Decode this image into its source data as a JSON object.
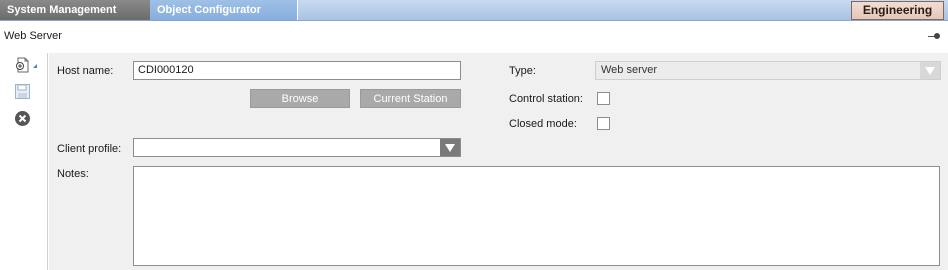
{
  "tabs": {
    "system_management": "System Management",
    "object_configurator": "Object Configurator",
    "engineering": "Engineering"
  },
  "page": {
    "title": "Web  Server"
  },
  "toolbar": {
    "new_icon": "new-document-icon",
    "save_icon": "save-icon",
    "close_icon": "close-circle-icon"
  },
  "form": {
    "host_name": {
      "label": "Host name:",
      "value": "CDI000120"
    },
    "browse_label": "Browse",
    "current_station_label": "Current Station",
    "type": {
      "label": "Type:",
      "value": "Web server"
    },
    "control_station": {
      "label": "Control station:",
      "checked": false
    },
    "closed_mode": {
      "label": "Closed mode:",
      "checked": false
    },
    "client_profile": {
      "label": "Client profile:",
      "value": ""
    },
    "notes": {
      "label": "Notes:",
      "value": ""
    }
  },
  "colors": {
    "active_tab": "#7a7a7a",
    "tab_bar": "#b8cde9",
    "engineering_tab": "#ead2c4",
    "disabled_button": "#a9a9a9"
  }
}
